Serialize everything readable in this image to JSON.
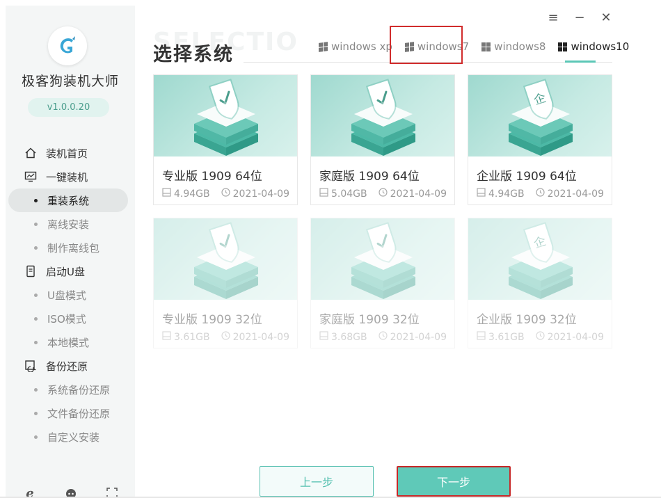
{
  "app": {
    "name": "极客狗装机大师",
    "version": "v1.0.0.20"
  },
  "window_controls": [
    "≡",
    "−",
    "✕"
  ],
  "sidebar": {
    "nav": [
      {
        "type": "main",
        "label": "装机首页",
        "icon": "home-icon"
      },
      {
        "type": "main",
        "label": "一键装机",
        "icon": "monitor-icon"
      },
      {
        "type": "sub",
        "label": "重装系统",
        "active": true
      },
      {
        "type": "sub",
        "label": "离线安装"
      },
      {
        "type": "sub",
        "label": "制作离线包"
      },
      {
        "type": "main",
        "label": "启动U盘",
        "icon": "usb-icon"
      },
      {
        "type": "sub",
        "label": "U盘模式"
      },
      {
        "type": "sub",
        "label": "ISO模式"
      },
      {
        "type": "sub",
        "label": "本地模式"
      },
      {
        "type": "main",
        "label": "备份还原",
        "icon": "backup-icon"
      },
      {
        "type": "sub",
        "label": "系统备份还原"
      },
      {
        "type": "sub",
        "label": "文件备份还原"
      },
      {
        "type": "sub",
        "label": "自定义安装"
      }
    ],
    "bottom_icons": [
      "browser-icon",
      "support-icon",
      "fullscreen-icon"
    ]
  },
  "page": {
    "ghost_title": "SELECTIO",
    "title": "选择系统"
  },
  "tabs": [
    {
      "label": "windows xp",
      "active": false
    },
    {
      "label": "windows7",
      "active": false
    },
    {
      "label": "windows8",
      "active": false
    },
    {
      "label": "windows10",
      "active": true
    }
  ],
  "cards": [
    {
      "name": "专业版 1909 64位",
      "size": "4.94GB",
      "date": "2021-04-09",
      "badge": "check",
      "available": true
    },
    {
      "name": "家庭版 1909 64位",
      "size": "5.04GB",
      "date": "2021-04-09",
      "badge": "check",
      "available": true
    },
    {
      "name": "企业版 1909 64位",
      "size": "4.94GB",
      "date": "2021-04-09",
      "badge": "企",
      "available": true
    },
    {
      "name": "专业版 1909 32位",
      "size": "3.61GB",
      "date": "2021-04-09",
      "badge": "check",
      "available": false
    },
    {
      "name": "家庭版 1909 32位",
      "size": "3.68GB",
      "date": "2021-04-09",
      "badge": "check",
      "available": false
    },
    {
      "name": "企业版 1909 32位",
      "size": "3.61GB",
      "date": "2021-04-09",
      "badge": "企",
      "available": false
    }
  ],
  "buttons": {
    "prev": "上一步",
    "next": "下一步"
  },
  "colors": {
    "accent": "#5fc9b8",
    "highlight": "#d12c2c"
  }
}
